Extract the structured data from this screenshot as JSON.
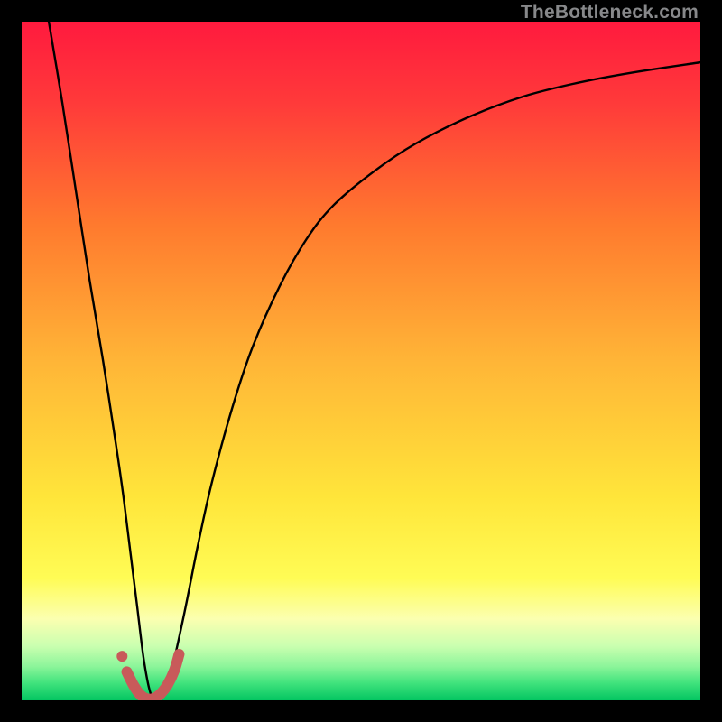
{
  "watermark": "TheBottleneck.com",
  "chart_data": {
    "type": "line",
    "title": "",
    "xlabel": "",
    "ylabel": "",
    "xlim": [
      0,
      100
    ],
    "ylim": [
      0,
      100
    ],
    "gradient_stops": [
      {
        "offset": 0.0,
        "color": "#ff1a3e"
      },
      {
        "offset": 0.12,
        "color": "#ff3a3a"
      },
      {
        "offset": 0.3,
        "color": "#ff7a2e"
      },
      {
        "offset": 0.5,
        "color": "#ffb537"
      },
      {
        "offset": 0.7,
        "color": "#ffe53a"
      },
      {
        "offset": 0.82,
        "color": "#fffc55"
      },
      {
        "offset": 0.88,
        "color": "#fbffb0"
      },
      {
        "offset": 0.92,
        "color": "#caffb0"
      },
      {
        "offset": 0.95,
        "color": "#8cf59a"
      },
      {
        "offset": 0.975,
        "color": "#3fe27c"
      },
      {
        "offset": 1.0,
        "color": "#03c561"
      }
    ],
    "series": [
      {
        "name": "main-curve",
        "x": [
          4,
          6,
          8,
          10,
          12,
          14,
          15,
          16,
          17,
          18,
          19,
          20,
          21,
          22,
          24,
          26,
          28,
          31,
          34,
          38,
          42,
          46,
          52,
          58,
          66,
          74,
          82,
          90,
          100
        ],
        "y": [
          100,
          88,
          75,
          62,
          50,
          37,
          30,
          22,
          14,
          6,
          1,
          0,
          1,
          4,
          13,
          23,
          32,
          43,
          52,
          61,
          68,
          73,
          78,
          82,
          86,
          89,
          91,
          92.5,
          94
        ]
      },
      {
        "name": "highlight-segment",
        "x": [
          15.5,
          16.5,
          17.5,
          18.5,
          19.5,
          20.5,
          21.5,
          22.5,
          23.2
        ],
        "y": [
          4.2,
          2.2,
          0.8,
          0.2,
          0.3,
          1.0,
          2.3,
          4.4,
          6.8
        ]
      },
      {
        "name": "highlight-dot",
        "x": [
          14.8
        ],
        "y": [
          6.5
        ]
      }
    ],
    "highlight_color": "#c85a5a",
    "curve_color": "#000000"
  }
}
